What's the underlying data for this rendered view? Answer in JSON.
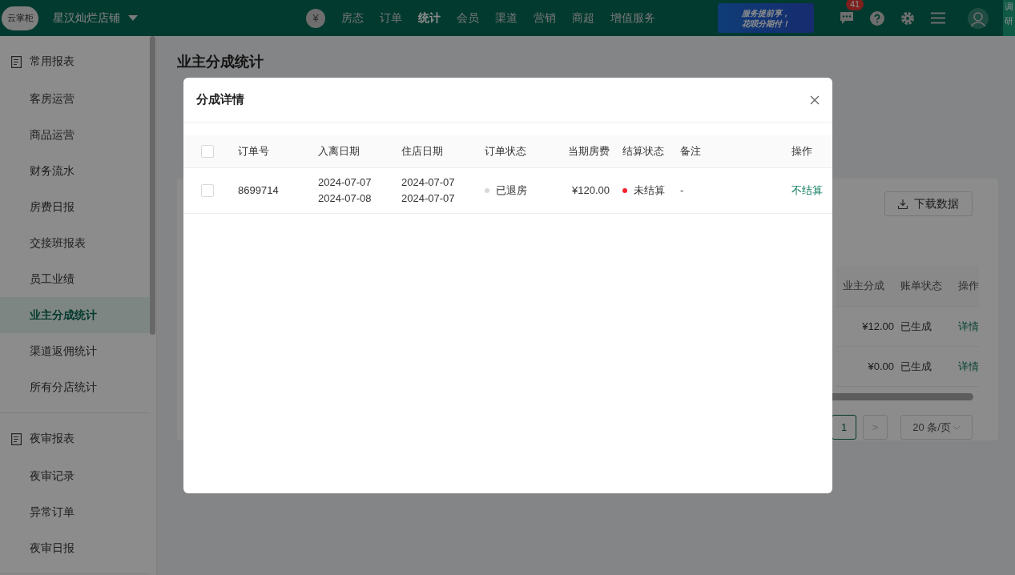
{
  "topbar": {
    "logo_text": "云掌柜",
    "store_name": "星汉灿烂店铺",
    "nav": [
      {
        "label": "房态",
        "selected": false
      },
      {
        "label": "订单",
        "selected": false
      },
      {
        "label": "统计",
        "selected": true
      },
      {
        "label": "会员",
        "selected": false
      },
      {
        "label": "渠道",
        "selected": false
      },
      {
        "label": "营销",
        "selected": false
      },
      {
        "label": "商超",
        "selected": false
      },
      {
        "label": "增值服务",
        "selected": false
      }
    ],
    "currency_icon": "¥",
    "banner_lines": [
      "服务提前享，",
      "花呗分期付！"
    ],
    "message_badge": "41",
    "side_tab": "调研"
  },
  "sidebar": {
    "groups": [
      {
        "title": "常用报表",
        "items": [
          {
            "label": "客房运营",
            "selected": false
          },
          {
            "label": "商品运营",
            "selected": false
          },
          {
            "label": "财务流水",
            "selected": false
          },
          {
            "label": "房费日报",
            "selected": false
          },
          {
            "label": "交接班报表",
            "selected": false
          },
          {
            "label": "员工业绩",
            "selected": false
          },
          {
            "label": "业主分成统计",
            "selected": true
          },
          {
            "label": "渠道返佣统计",
            "selected": false
          },
          {
            "label": "所有分店统计",
            "selected": false
          }
        ]
      },
      {
        "title": "夜审报表",
        "items": [
          {
            "label": "夜审记录",
            "selected": false
          },
          {
            "label": "异常订单",
            "selected": false
          },
          {
            "label": "夜审日报",
            "selected": false
          }
        ]
      }
    ]
  },
  "page": {
    "title": "业主分成统计",
    "download_button": "下载数据",
    "columns": [
      "业主分成",
      "账单状态",
      "操作"
    ],
    "rows": [
      {
        "share": "¥12.00",
        "status": "已生成",
        "action": "详情"
      },
      {
        "share": "¥0.00",
        "status": "已生成",
        "action": "详情"
      }
    ],
    "pagination": {
      "current_page": "1",
      "next": ">",
      "page_size": "20 条/页"
    }
  },
  "modal": {
    "title": "分成详情",
    "select_all_checked": false,
    "columns": [
      "订单号",
      "入离日期",
      "住店日期",
      "订单状态",
      "当期房费",
      "结算状态",
      "备注",
      "操作"
    ],
    "rows": [
      {
        "selected": false,
        "order_no": "8699714",
        "in_out_dates": [
          "2024-07-07",
          "2024-07-08"
        ],
        "stay_dates": [
          "2024-07-07",
          "2024-07-07"
        ],
        "order_status": {
          "text": "已退房",
          "color": "#d9d9d9"
        },
        "fee": "¥120.00",
        "settle_status": {
          "text": "未结算",
          "color": "#f5222d"
        },
        "note": "-",
        "action": "不结算"
      }
    ]
  }
}
